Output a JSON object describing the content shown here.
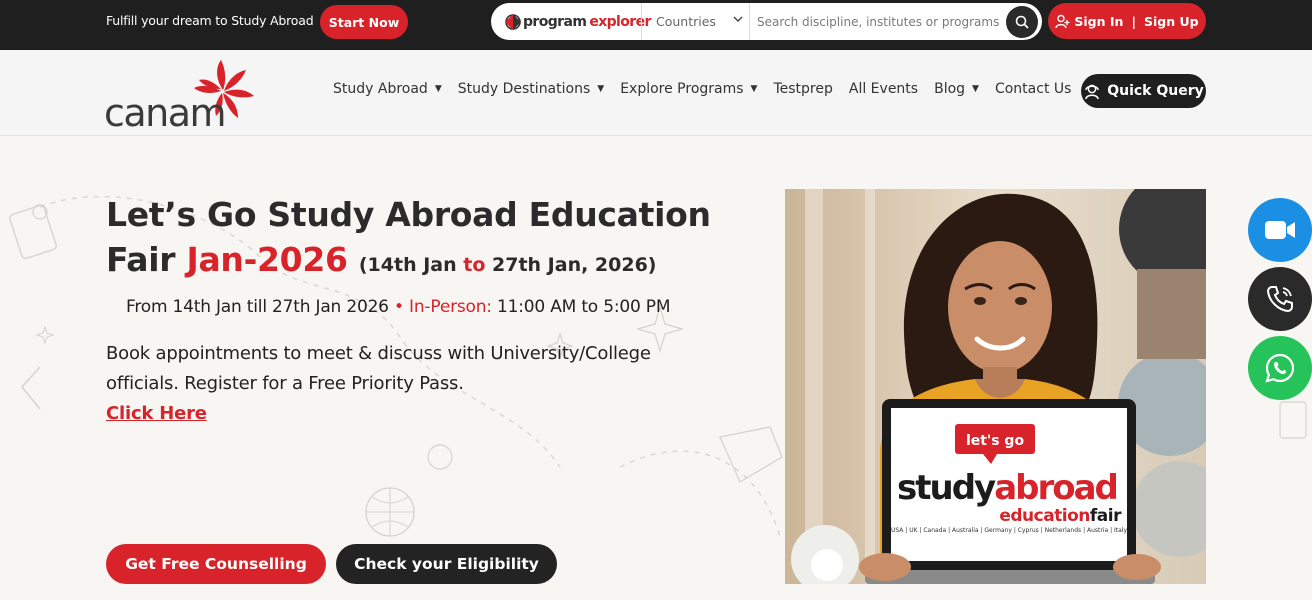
{
  "topbar": {
    "tagline": "Fulfill your dream to Study Abroad",
    "start_now": "Start Now",
    "program_explorer": {
      "brand_part1": "program",
      "brand_part2": "explorer"
    },
    "countries": "Countries",
    "search_placeholder": "Search discipline, institutes or programs",
    "sign_in": "Sign In",
    "sign_up": "Sign Up"
  },
  "logo": {
    "text": "canam"
  },
  "nav": {
    "items": [
      {
        "label": "Study Abroad",
        "has_caret": true
      },
      {
        "label": "Study Destinations",
        "has_caret": true
      },
      {
        "label": "Explore Programs",
        "has_caret": true
      },
      {
        "label": "Testprep",
        "has_caret": false
      },
      {
        "label": "All Events",
        "has_caret": false
      },
      {
        "label": "Blog",
        "has_caret": true
      },
      {
        "label": "Contact Us",
        "has_caret": false
      }
    ],
    "quick_query": "Quick Query"
  },
  "hero": {
    "title_line1": "Let’s Go Study Abroad Education",
    "title_fair": "Fair",
    "title_month": "Jan-2026",
    "dates_open": "(14th Jan",
    "dates_to": "to",
    "dates_close": "27th Jan, 2026)",
    "when_prefix": "From 14th Jan till 27th Jan 2026",
    "when_mode": "• In-Person:",
    "when_time": "11:00 AM to 5:00 PM",
    "desc": "Book appointments to meet & discuss with University/College officials. Register for a Free Priority Pass.",
    "click_here": "Click Here",
    "btn_counselling": "Get Free Counselling",
    "btn_eligibility": "Check your Eligibility"
  },
  "laptop_screen": {
    "lets_go": "let's go",
    "study": "study",
    "abroad": "abroad",
    "education": "education",
    "fair": "fair",
    "countries": "USA | UK | Canada | Australia | Germany | Cyprus | Netherlands | Austria | Italy"
  },
  "floating": {
    "video": "video-call-icon",
    "call": "phone-icon",
    "whatsapp": "whatsapp-icon"
  },
  "colors": {
    "brand_red": "#d8232a",
    "dark": "#1f1f1f",
    "video_blue": "#1a8fe3",
    "whatsapp_green": "#25c35a"
  }
}
